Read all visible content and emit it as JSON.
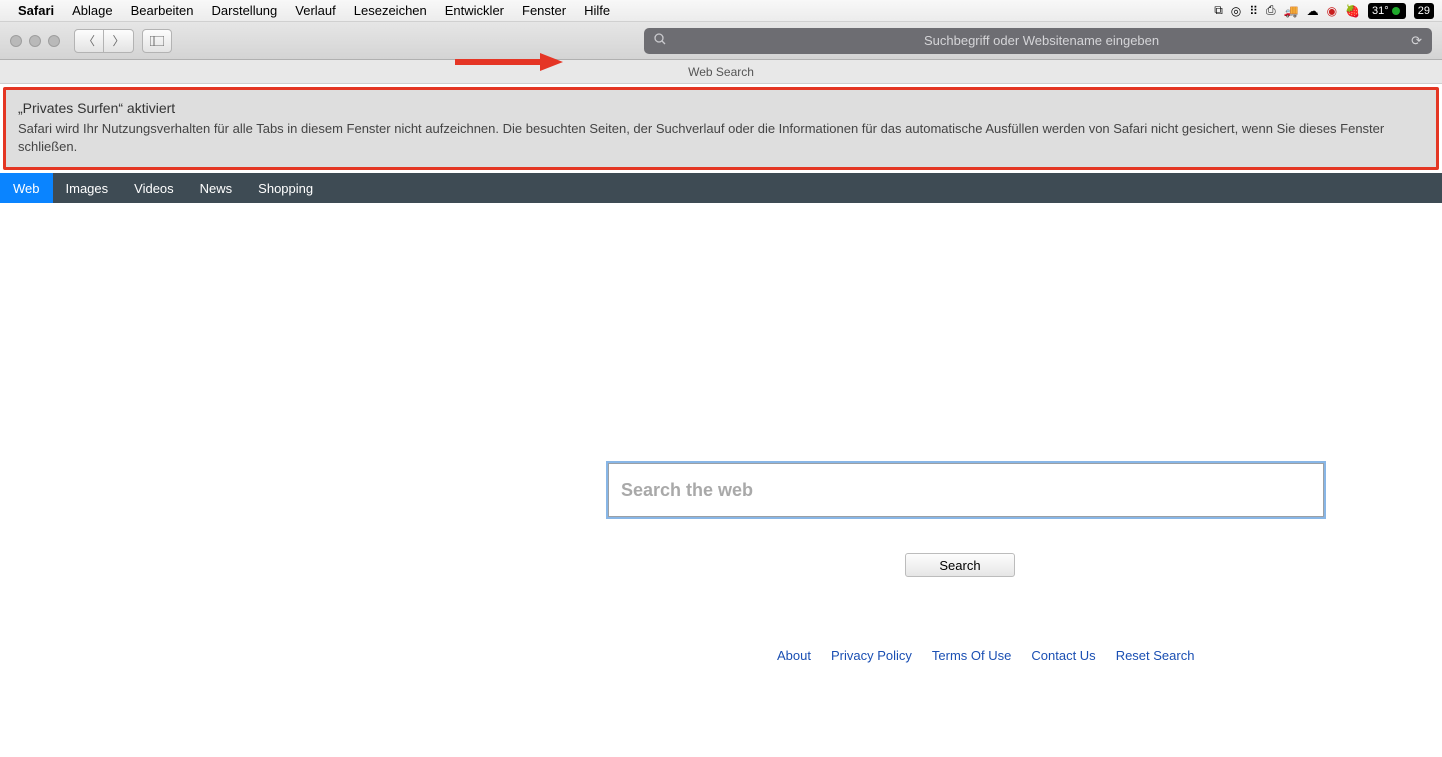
{
  "menubar": {
    "app": "Safari",
    "items": [
      "Ablage",
      "Bearbeiten",
      "Darstellung",
      "Verlauf",
      "Lesezeichen",
      "Entwickler",
      "Fenster",
      "Hilfe"
    ]
  },
  "tray": {
    "temp": "31°",
    "count": "29"
  },
  "toolbar": {
    "address_placeholder": "Suchbegriff oder Websitename eingeben"
  },
  "tabtitle": "Web Search",
  "private_banner": {
    "title": "„Privates Surfen“ aktiviert",
    "body": "Safari wird Ihr Nutzungsverhalten für alle Tabs in diesem Fenster nicht aufzeichnen. Die besuchten Seiten, der Suchverlauf oder die Informationen für das automatische Ausfüllen werden von Safari nicht gesichert, wenn Sie dieses Fenster schließen."
  },
  "navtabs": [
    "Web",
    "Images",
    "Videos",
    "News",
    "Shopping"
  ],
  "search": {
    "placeholder": "Search the web",
    "button": "Search"
  },
  "footer": [
    "About",
    "Privacy Policy",
    "Terms Of Use",
    "Contact Us",
    "Reset Search"
  ]
}
